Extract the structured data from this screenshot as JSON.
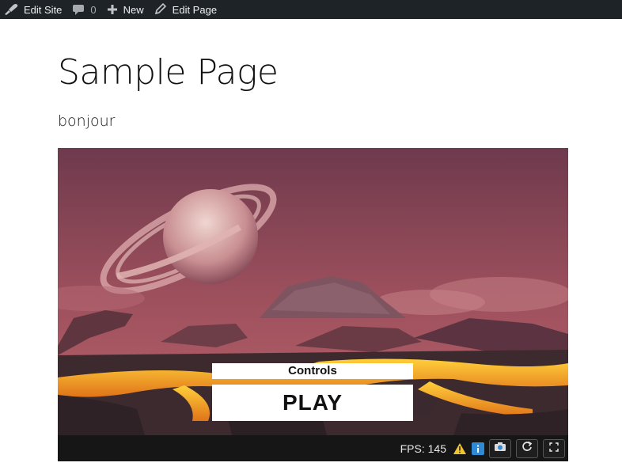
{
  "admin_bar": {
    "edit_site": "Edit Site",
    "comments_count": "0",
    "new_label": "New",
    "edit_page": "Edit Page",
    "background_color": "#1d2327"
  },
  "page": {
    "title": "Sample Page",
    "text": "bonjour"
  },
  "game": {
    "controls_label": "Controls",
    "play_label": "PLAY",
    "fps_text": "FPS: 145",
    "icons": [
      "warning-icon",
      "info-icon",
      "camera-icon",
      "reload-icon",
      "fullscreen-icon"
    ]
  },
  "colors": {
    "sky": "#7a3f55",
    "lava": "#f29a1c",
    "toolbar": "#161616"
  }
}
